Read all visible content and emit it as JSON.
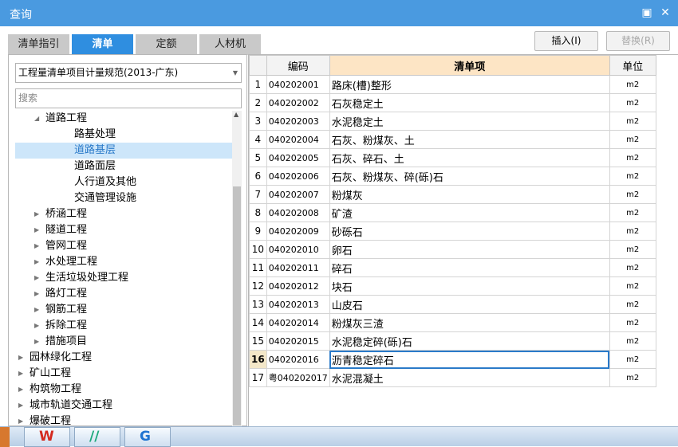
{
  "window": {
    "title": "查询",
    "restore_glyph": "▣",
    "close_glyph": "✕"
  },
  "tabs": [
    "清单指引",
    "清单",
    "定额",
    "人材机"
  ],
  "active_tab": 1,
  "buttons": {
    "insert": "插入(I)",
    "replace": "替换(R)"
  },
  "left": {
    "standard": "工程量清单项目计量规范(2013-广东)",
    "search_placeholder": "搜索",
    "tree": [
      {
        "label": "道路工程",
        "level": 1,
        "arrow": "◢",
        "expanded": true
      },
      {
        "label": "路基处理",
        "level": 2
      },
      {
        "label": "道路基层",
        "level": 2,
        "selected": true
      },
      {
        "label": "道路面层",
        "level": 2
      },
      {
        "label": "人行道及其他",
        "level": 2
      },
      {
        "label": "交通管理设施",
        "level": 2
      },
      {
        "label": "桥涵工程",
        "level": 1,
        "arrow": "▶"
      },
      {
        "label": "隧道工程",
        "level": 1,
        "arrow": "▶"
      },
      {
        "label": "管网工程",
        "level": 1,
        "arrow": "▶"
      },
      {
        "label": "水处理工程",
        "level": 1,
        "arrow": "▶"
      },
      {
        "label": "生活垃圾处理工程",
        "level": 1,
        "arrow": "▶"
      },
      {
        "label": "路灯工程",
        "level": 1,
        "arrow": "▶"
      },
      {
        "label": "钢筋工程",
        "level": 1,
        "arrow": "▶"
      },
      {
        "label": "拆除工程",
        "level": 1,
        "arrow": "▶"
      },
      {
        "label": "措施项目",
        "level": 1,
        "arrow": "▶"
      },
      {
        "label": "园林绿化工程",
        "level": 0,
        "arrow": "▶"
      },
      {
        "label": "矿山工程",
        "level": 0,
        "arrow": "▶"
      },
      {
        "label": "构筑物工程",
        "level": 0,
        "arrow": "▶"
      },
      {
        "label": "城市轨道交通工程",
        "level": 0,
        "arrow": "▶"
      },
      {
        "label": "爆破工程",
        "level": 0,
        "arrow": "▶"
      }
    ]
  },
  "table": {
    "headers": {
      "rownum": "",
      "code": "编码",
      "name": "清单项",
      "unit": "单位"
    },
    "current_row": 16,
    "rows": [
      {
        "n": "1",
        "code": "040202001",
        "name": "路床(槽)整形",
        "unit": "m2"
      },
      {
        "n": "2",
        "code": "040202002",
        "name": "石灰稳定土",
        "unit": "m2"
      },
      {
        "n": "3",
        "code": "040202003",
        "name": "水泥稳定土",
        "unit": "m2"
      },
      {
        "n": "4",
        "code": "040202004",
        "name": "石灰、粉煤灰、土",
        "unit": "m2"
      },
      {
        "n": "5",
        "code": "040202005",
        "name": "石灰、碎石、土",
        "unit": "m2"
      },
      {
        "n": "6",
        "code": "040202006",
        "name": "石灰、粉煤灰、碎(砾)石",
        "unit": "m2"
      },
      {
        "n": "7",
        "code": "040202007",
        "name": "粉煤灰",
        "unit": "m2"
      },
      {
        "n": "8",
        "code": "040202008",
        "name": "矿渣",
        "unit": "m2"
      },
      {
        "n": "9",
        "code": "040202009",
        "name": "砂砾石",
        "unit": "m2"
      },
      {
        "n": "10",
        "code": "040202010",
        "name": "卵石",
        "unit": "m2"
      },
      {
        "n": "11",
        "code": "040202011",
        "name": "碎石",
        "unit": "m2"
      },
      {
        "n": "12",
        "code": "040202012",
        "name": "块石",
        "unit": "m2"
      },
      {
        "n": "13",
        "code": "040202013",
        "name": "山皮石",
        "unit": "m2"
      },
      {
        "n": "14",
        "code": "040202014",
        "name": "粉煤灰三渣",
        "unit": "m2"
      },
      {
        "n": "15",
        "code": "040202015",
        "name": "水泥稳定碎(砾)石",
        "unit": "m2"
      },
      {
        "n": "16",
        "code": "040202016",
        "name": "沥青稳定碎石",
        "unit": "m2"
      },
      {
        "n": "17",
        "code": "粤040202017",
        "name": "水泥混凝土",
        "unit": "m2"
      }
    ]
  },
  "taskbar": [
    "wps-icon",
    "paint-icon",
    "browser-icon"
  ]
}
